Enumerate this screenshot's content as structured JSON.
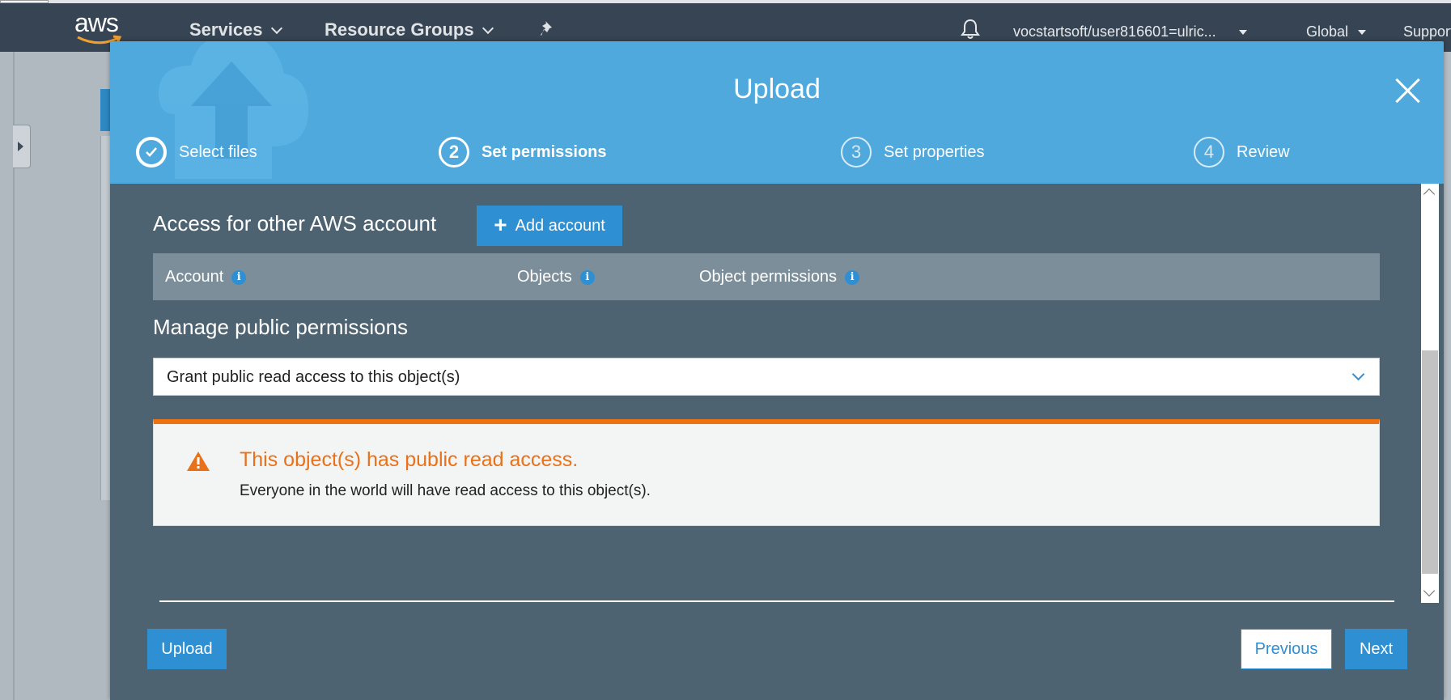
{
  "topnav": {
    "logo_text": "aws",
    "services_label": "Services",
    "resource_groups_label": "Resource Groups",
    "account_label": "vocstartsoft/user816601=ulric...",
    "region_label": "Global",
    "support_label": "Support"
  },
  "modal": {
    "title": "Upload",
    "steps": [
      {
        "number": "1",
        "label": "Select files",
        "state": "done"
      },
      {
        "number": "2",
        "label": "Set permissions",
        "state": "active"
      },
      {
        "number": "3",
        "label": "Set properties",
        "state": "future"
      },
      {
        "number": "4",
        "label": "Review",
        "state": "future"
      }
    ],
    "other_accounts": {
      "title": "Access for other AWS account",
      "add_button": "Add account",
      "columns": [
        "Account",
        "Objects",
        "Object permissions"
      ]
    },
    "public_permissions": {
      "title": "Manage public permissions",
      "selected_option": "Grant public read access to this object(s)"
    },
    "alert": {
      "title": "This object(s) has public read access.",
      "message": "Everyone in the world will have read access to this object(s)."
    },
    "footer": {
      "upload_label": "Upload",
      "previous_label": "Previous",
      "next_label": "Next"
    }
  },
  "colors": {
    "nav_bg": "#364453",
    "header_blue": "#4fa9dd",
    "body_bg": "#4d6372",
    "accent": "#2e8fd3",
    "warning": "#ec7211"
  }
}
